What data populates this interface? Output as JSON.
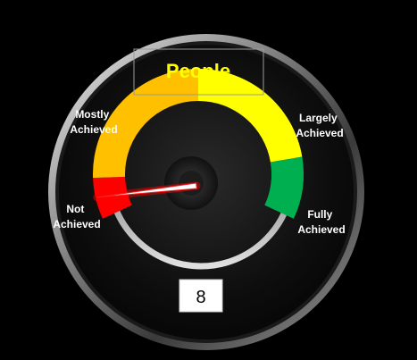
{
  "chart_data": {
    "type": "gauge",
    "title": "People",
    "value": 8,
    "range": [
      0,
      100
    ],
    "bands": [
      {
        "label": "Not Achieved",
        "from": 0,
        "to": 10,
        "color": "#ff0000"
      },
      {
        "label": "Mostly Achieved",
        "from": 10,
        "to": 50,
        "color": "#ffc000"
      },
      {
        "label": "Largely Achieved",
        "from": 50,
        "to": 85,
        "color": "#ffff00"
      },
      {
        "label": "Fully Achieved",
        "from": 85,
        "to": 100,
        "color": "#00b050"
      }
    ]
  },
  "labels": {
    "not_achieved": [
      "Not",
      "Achieved"
    ],
    "mostly_achieved": [
      "Mostly",
      "Achieved"
    ],
    "largely_achieved": [
      "Largely",
      "Achieved"
    ],
    "fully_achieved": [
      "Fully",
      "Achieved"
    ]
  },
  "colors": {
    "background": "#000000",
    "title_text": "#ffff00",
    "label_text": "#ffffff",
    "needle": "#ff2020"
  }
}
